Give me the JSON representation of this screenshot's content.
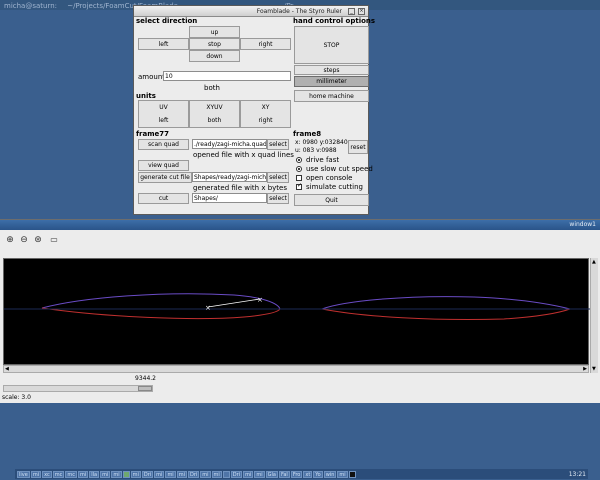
{
  "background_terminal": {
    "user_host": "micha@saturn:",
    "path": "~/Projects/FoamCut/FoamBlade",
    "short": "~/Pr"
  },
  "foamblade": {
    "title": "Foamblade - The Styro Ruler",
    "select_direction": {
      "heading": "select direction",
      "up": "up",
      "left": "left",
      "stop": "stop",
      "right": "right",
      "down": "down"
    },
    "amount": {
      "label": "amount",
      "value": "10",
      "mode": "both"
    },
    "units": {
      "heading": "units",
      "uv": "UV",
      "xyuv": "XYUV",
      "xy": "XY",
      "left": "left",
      "both": "both",
      "right": "right"
    },
    "hand_control": {
      "heading": "hand control options",
      "stop": "STOP",
      "steps": "steps",
      "millimeter": "millimeter",
      "home_machine": "home machine"
    },
    "frame77": {
      "heading": "frame77",
      "scan_quad": "scan quad",
      "quad_path": "./ready/zagi-micha.quad",
      "select1": "select",
      "opened_msg": "opened file with x quad lines",
      "view_quad": "view quad",
      "generate_cut_file": "generate cut file",
      "shapes_path": "Shapes/ready/zagi-mich",
      "select2": "select",
      "generated_msg": "generated file with x bytes",
      "cut": "cut",
      "cut_path": "Shapes/",
      "select3": "select"
    },
    "frame8": {
      "heading": "frame8",
      "xy_readout": "x: 0980 y:032840",
      "uv_readout": "u: 083  v:0988",
      "reset": "reset",
      "drive_fast": "drive fast",
      "use_slow_cut_speed": "use slow cut speed",
      "open_console": "open console",
      "simulate_cutting": "simulate cutting",
      "quit": "Quit",
      "drive_fast_on": true,
      "slow_cut_on": true,
      "open_console_on": false,
      "simulate_on": true
    }
  },
  "window1": {
    "title": "window1",
    "toolbar": {
      "zoom_in": "zoom-in-icon",
      "zoom_out": "zoom-out-icon",
      "zoom_fit": "zoom-fit-icon",
      "open": "folder-icon"
    },
    "ruler_value": "9344.2",
    "scale": "scale: 3.0"
  },
  "taskbar": {
    "items": [
      "live",
      "mi",
      "xc",
      "mc",
      "mc",
      "mi",
      "lla",
      "mi",
      "mi",
      "",
      "mi",
      "Dri",
      "mi",
      "mi",
      "mi",
      "Dri",
      "mi",
      "mi",
      "",
      "Dri",
      "mi",
      "mi",
      "Gla",
      "Fal",
      "Fro",
      "xt",
      "Yo",
      "win",
      "mi",
      ""
    ],
    "clock": "13:21"
  },
  "colors": {
    "desktop": "#3a5f8e",
    "canvas": "#000000",
    "outline_upper": "#6a4cc6",
    "outline_lower": "#c0302f",
    "wire": "#ffffff"
  }
}
